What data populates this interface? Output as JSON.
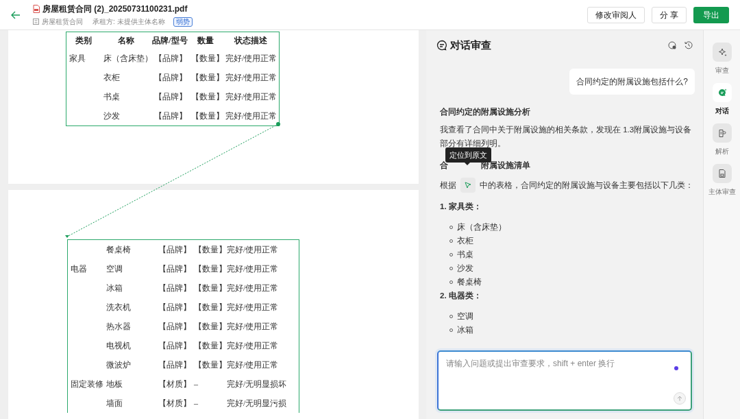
{
  "header": {
    "title": "房屋租赁合同 (2)_20250731100231.pdf",
    "doc_type": "房屋租赁合同",
    "party": "承租方: 未提供主体名称",
    "badge": "弱势",
    "buttons": [
      {
        "label": "修改审阅人",
        "kind": "default"
      },
      {
        "label": "分 享",
        "kind": "default"
      },
      {
        "label": "导出",
        "kind": "primary"
      }
    ]
  },
  "document": {
    "columns": [
      "类别",
      "名称",
      "品牌/型号",
      "数量",
      "状态描述"
    ],
    "pages": [
      {
        "rows": [
          {
            "category": "家具",
            "name": "床（含床垫）",
            "brand": "【品牌】",
            "quantity": "【数量】",
            "status": "完好/使用正常"
          },
          {
            "name": "衣柜",
            "brand": "【品牌】",
            "quantity": "【数量】",
            "status": "完好/使用正常"
          },
          {
            "name": "书桌",
            "brand": "【品牌】",
            "quantity": "【数量】",
            "status": "完好/使用正常"
          },
          {
            "name": "沙发",
            "brand": "【品牌】",
            "quantity": "【数量】",
            "status": "完好/使用正常"
          }
        ]
      },
      {
        "rows": [
          {
            "name": "餐桌椅",
            "brand": "【品牌】",
            "quantity": "【数量】",
            "status": "完好/使用正常"
          },
          {
            "category": "电器",
            "name": "空调",
            "brand": "【品牌】",
            "quantity": "【数量】",
            "status": "完好/使用正常"
          },
          {
            "name": "冰箱",
            "brand": "【品牌】",
            "quantity": "【数量】",
            "status": "完好/使用正常"
          },
          {
            "name": "洗衣机",
            "brand": "【品牌】",
            "quantity": "【数量】",
            "status": "完好/使用正常"
          },
          {
            "name": "热水器",
            "brand": "【品牌】",
            "quantity": "【数量】",
            "status": "完好/使用正常"
          },
          {
            "name": "电视机",
            "brand": "【品牌】",
            "quantity": "【数量】",
            "status": "完好/使用正常"
          },
          {
            "name": "微波炉",
            "brand": "【品牌】",
            "quantity": "【数量】",
            "status": "完好/使用正常"
          },
          {
            "category": "固定装修",
            "name": "地板",
            "brand": "【材质】",
            "quantity": "–",
            "status": "完好/无明显损坏"
          },
          {
            "name": "墙面",
            "brand": "【材质】",
            "quantity": "–",
            "status": "完好/无明显污损"
          }
        ]
      }
    ]
  },
  "chat": {
    "title": "对话审查",
    "user_message": "合同约定的附属设施包括什么?",
    "heading": "合同约定的附属设施分析",
    "paragraph": "我查看了合同中关于附属设施的相关条款，发现在 1.3附属设施与设备部分有详细列明。",
    "heading2_visible": [
      "合",
      "附属设施清单"
    ],
    "tooltip": "定位到原文",
    "intro_before": "根据",
    "intro_after": "中的表格，合同约定的附属设施与设备主要包括以下几类：",
    "lists": [
      {
        "title": "1. 家具类：",
        "items": [
          "床（含床垫）",
          "衣柜",
          "书桌",
          "沙发",
          "餐桌椅"
        ]
      },
      {
        "title": "2. 电器类：",
        "items": [
          "空调",
          "冰箱"
        ]
      }
    ],
    "input": {
      "placeholder": "请输入问题或提出审查要求，shift + enter 换行"
    }
  },
  "rail": [
    {
      "label": "审查",
      "selected": false
    },
    {
      "label": "对话",
      "selected": true
    },
    {
      "label": "解析",
      "selected": false
    },
    {
      "label": "主体审查",
      "selected": false
    }
  ]
}
